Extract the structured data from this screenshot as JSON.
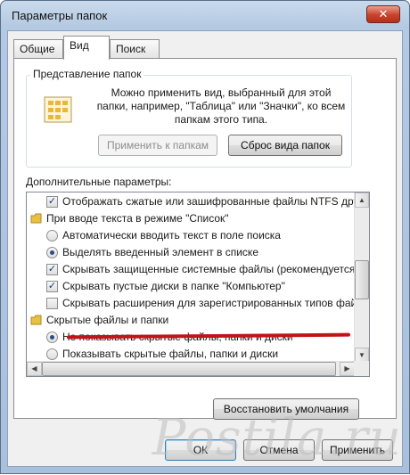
{
  "window": {
    "title": "Параметры папок",
    "close_glyph": "✕"
  },
  "tabs": [
    {
      "label": "Общие",
      "active": false
    },
    {
      "label": "Вид",
      "active": true
    },
    {
      "label": "Поиск",
      "active": false
    }
  ],
  "folder_views": {
    "group_label": "Представление папок",
    "description": "Можно применить вид, выбранный для этой папки, например, \"Таблица\" или \"Значки\", ко всем папкам этого типа.",
    "apply_button": "Применить к папкам",
    "reset_button": "Сброс вида папок"
  },
  "advanced": {
    "label": "Дополнительные параметры:",
    "items": [
      {
        "kind": "checkbox",
        "checked": true,
        "level": 1,
        "label": "Отображать сжатые или зашифрованные файлы NTFS другим цветом"
      },
      {
        "kind": "folder",
        "checked": null,
        "level": 0,
        "label": "При вводе текста в режиме \"Список\""
      },
      {
        "kind": "radio",
        "checked": false,
        "level": 1,
        "label": "Автоматически вводить текст в поле поиска"
      },
      {
        "kind": "radio",
        "checked": true,
        "level": 1,
        "label": "Выделять введенный элемент в списке"
      },
      {
        "kind": "checkbox",
        "checked": true,
        "level": 1,
        "label": "Скрывать защищенные системные файлы (рекомендуется)"
      },
      {
        "kind": "checkbox",
        "checked": true,
        "level": 1,
        "label": "Скрывать пустые диски в папке \"Компьютер\""
      },
      {
        "kind": "checkbox",
        "checked": false,
        "level": 1,
        "label": "Скрывать расширения для зарегистрированных типов файлов"
      },
      {
        "kind": "folder",
        "checked": null,
        "level": 0,
        "label": "Скрытые файлы и папки"
      },
      {
        "kind": "radio",
        "checked": true,
        "level": 1,
        "label": "Не показывать скрытые файлы, папки и диски"
      },
      {
        "kind": "radio",
        "checked": false,
        "level": 1,
        "label": "Показывать скрытые файлы, папки и диски"
      }
    ],
    "restore_button": "Восстановить умолчания"
  },
  "dialog_buttons": {
    "ok": "ОК",
    "cancel": "Отмена",
    "apply": "Применить"
  },
  "watermark": {
    "text": "Postila.ru"
  },
  "colors": {
    "highlight_line": "#c0141a",
    "checkmark": "#1d3a6d"
  }
}
